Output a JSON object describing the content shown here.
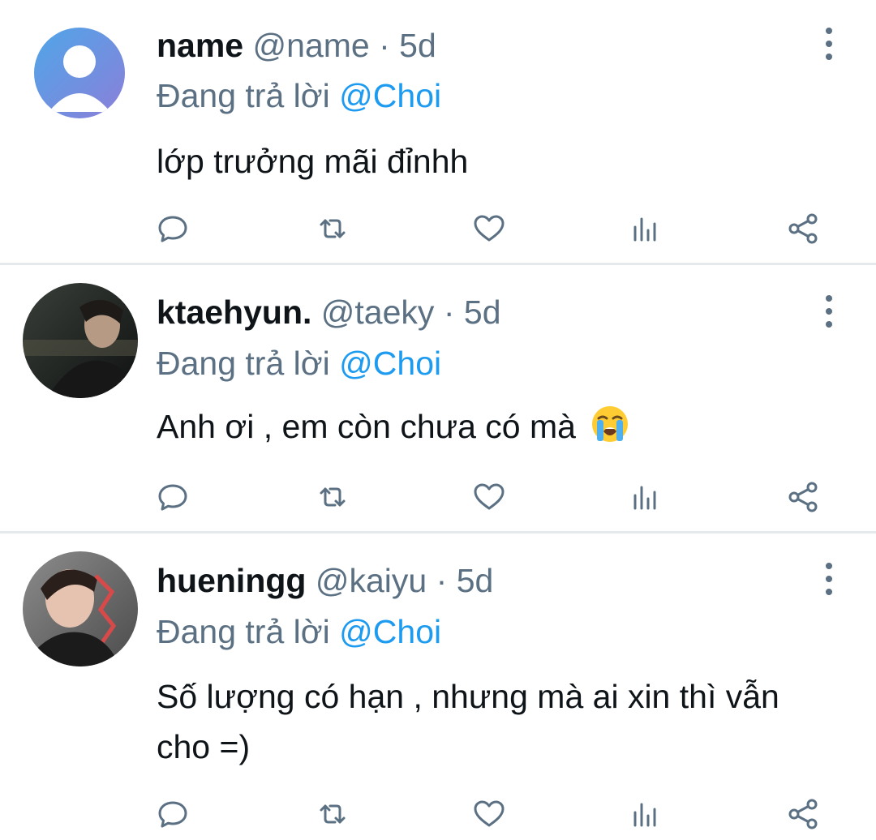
{
  "tweets": [
    {
      "name": "name",
      "handle": "@name",
      "separator": "·",
      "time": "5d",
      "reply_prefix": "Đang trả lời",
      "reply_mention": "@Choi",
      "text": "lớp trưởng mãi đỉnhh",
      "avatar": "default-avatar"
    },
    {
      "name": "ktaehyun.",
      "handle": "@taeky",
      "separator": "·",
      "time": "5d",
      "reply_prefix": "Đang trả lời",
      "reply_mention": "@Choi",
      "text": "Anh ơi , em còn chưa có mà",
      "emoji": "loudly-crying-face",
      "avatar": "photo-avatar"
    },
    {
      "name": "hueningg",
      "handle": "@kaiyu",
      "separator": "·",
      "time": "5d",
      "reply_prefix": "Đang trả lời",
      "reply_mention": "@Choi",
      "text": "Số lượng có hạn , nhưng mà ai xin thì vẫn cho =)",
      "avatar": "photo-avatar"
    }
  ],
  "icons": {
    "reply": "reply-icon",
    "retweet": "retweet-icon",
    "like": "heart-icon",
    "views": "analytics-icon",
    "share": "share-icon",
    "more": "more-vertical-icon"
  },
  "colors": {
    "text": "#0f1419",
    "secondary": "#5b7083",
    "mention": "#1d9bf0",
    "divider": "#e6e9ec"
  }
}
